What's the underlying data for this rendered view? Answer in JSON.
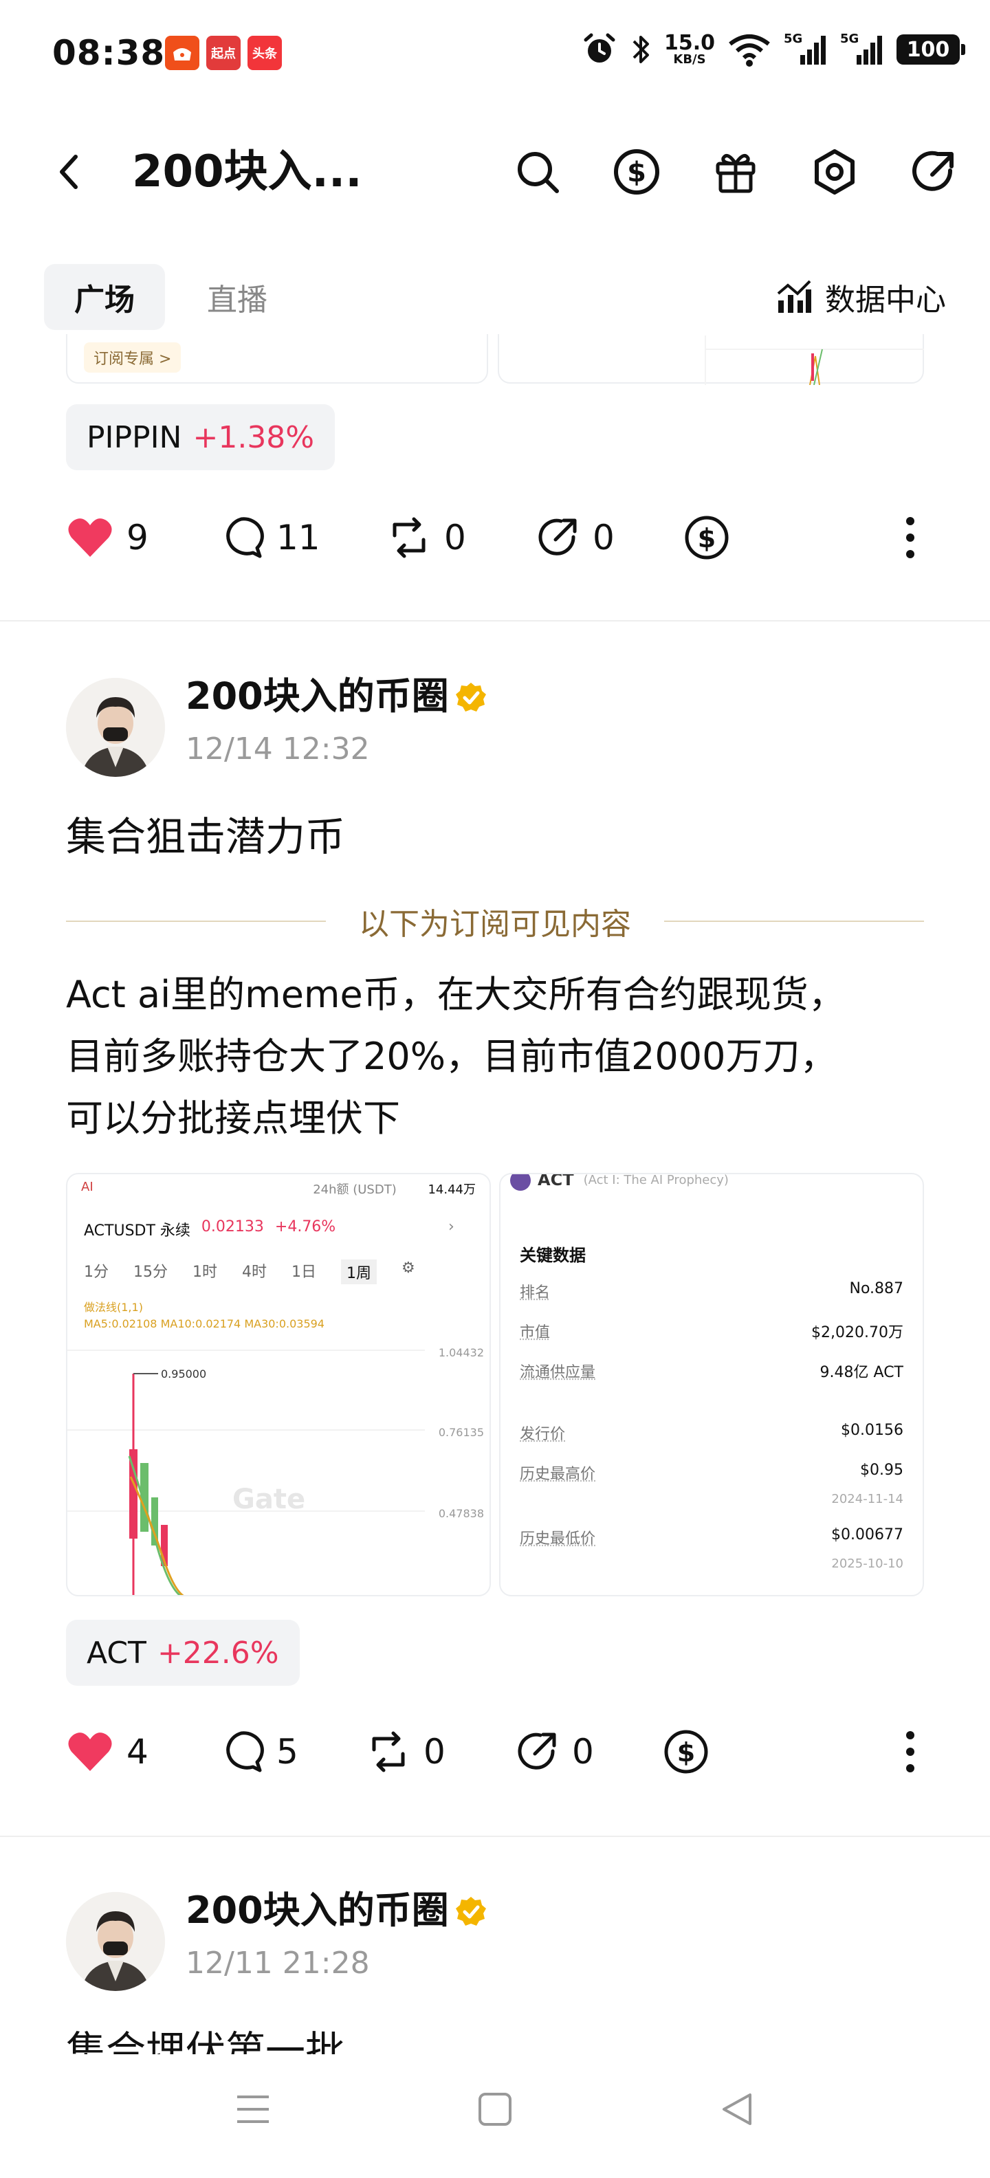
{
  "status_bar": {
    "time": "08:38",
    "app_badges": [
      "",
      "起点",
      "头条"
    ],
    "net_speed_value": "15.0",
    "net_speed_unit": "KB/S",
    "network_1": "5G",
    "network_2": "5G",
    "battery": "100"
  },
  "nav": {
    "title": "200块入...",
    "icons": [
      "search-icon",
      "dollar-icon",
      "gift-icon",
      "settings-icon",
      "share-icon"
    ]
  },
  "tabs": {
    "square": "广场",
    "live": "直播",
    "data_center": "数据中心"
  },
  "post_prev": {
    "chip": "订阅专属 >",
    "token": {
      "name": "PIPPIN",
      "change": "+1.38%"
    },
    "likes": "9",
    "comments": "11",
    "reposts": "0",
    "shares": "0"
  },
  "post_main": {
    "author": "200块入的币圈",
    "time": "12/14 12:32",
    "title": "集合狙击潜力币",
    "subscriber_divider": "以下为订阅可见内容",
    "body_lines": [
      "Act ai里的meme币，在大交所有合约跟现货，",
      "目前多账持仓大了20%，目前市值2000万刀，",
      "可以分批接点埋伏下"
    ],
    "chart_image": {
      "top_left": "AI",
      "top_meta": "24h额 (USDT)",
      "top_volume": "14.44万",
      "pair": "ACTUSDT 永续",
      "price": "0.02133",
      "pct": "+4.76%",
      "timeframes": [
        "1分",
        "15分",
        "1时",
        "4时",
        "1日",
        "1周"
      ],
      "active_timeframe": "1周",
      "legend_1": "做法线(1,1)",
      "legend_2": "MA5:0.02108  MA10:0.02174  MA30:0.03594",
      "high_marker": "0.95000",
      "axis_values": [
        "1.04432",
        "0.76135",
        "0.47838"
      ],
      "watermark": "Gate"
    },
    "key_data_image": {
      "token": "ACT",
      "token_full": "(Act I: The AI Prophecy)",
      "title": "关键数据",
      "rows": [
        {
          "k": "排名",
          "v": "No.887"
        },
        {
          "k": "市值",
          "v": "$2,020.70万"
        },
        {
          "k": "流通供应量",
          "v": "9.48亿 ACT"
        },
        {
          "k": "发行价",
          "v": "$0.0156"
        },
        {
          "k": "历史最高价",
          "v": "$0.95"
        },
        {
          "k": "历史最低价",
          "v": "$0.00677"
        }
      ],
      "ath_date": "2024-11-14",
      "atl_date": "2025-10-10"
    },
    "token": {
      "name": "ACT",
      "change": "+22.6%"
    },
    "likes": "4",
    "comments": "5",
    "reposts": "0",
    "shares": "0"
  },
  "post_next": {
    "author": "200块入的币圈",
    "time": "12/11 21:28",
    "title": "集合埋伏第一批"
  },
  "colors": {
    "like_red": "#f03a5f",
    "gain_red": "#e8365d",
    "verified_gold": "#f4b500",
    "subscriber_gold": "#8a6a35"
  }
}
